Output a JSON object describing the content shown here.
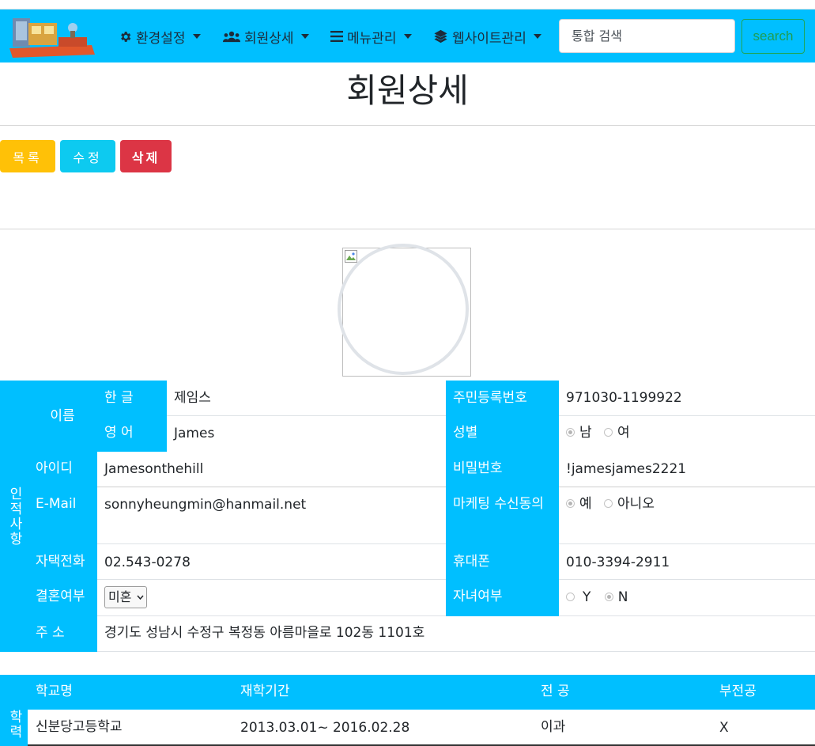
{
  "nav": {
    "items": [
      {
        "label": "환경설정",
        "icon": "gear-icon"
      },
      {
        "label": "회원상세",
        "icon": "users-icon"
      },
      {
        "label": "메뉴관리",
        "icon": "list-icon"
      },
      {
        "label": "웹사이트관리",
        "icon": "layers-icon"
      }
    ],
    "search_placeholder": "통합 검색",
    "search_button": "search"
  },
  "page": {
    "title": "회원상세"
  },
  "actions": {
    "list": "목록",
    "edit": "수정",
    "delete": "삭제"
  },
  "colors": {
    "navbar": "#00bfff",
    "header_cell": "#00bfff",
    "list_button": "#ffc107",
    "edit_button": "#0dcaf0",
    "delete_button": "#dc3545"
  },
  "personal": {
    "section_label": "인적사항",
    "name_label": "이름",
    "korean_label": "한 글",
    "korean_value": "제임스",
    "english_label": "영 어",
    "english_value": "James",
    "rrn_label": "주민등록번호",
    "rrn_value": "971030-1199922",
    "gender_label": "성별",
    "gender_male": "남",
    "gender_female": "여",
    "gender_selected": "남",
    "id_label": "아이디",
    "id_value": "Jamesonthehill",
    "password_label": "비밀번호",
    "password_value": "!jamesjames2221",
    "email_label": "E-Mail",
    "email_value": "sonnyheungmin@hanmail.net",
    "marketing_label": "마케팅 수신동의",
    "marketing_yes": "예",
    "marketing_no": "아니오",
    "marketing_selected": "예",
    "home_phone_label": "자택전화",
    "home_phone_value": "02.543-0278",
    "mobile_label": "휴대폰",
    "mobile_value": "010-3394-2911",
    "marital_label": "결혼여부",
    "marital_value": "미혼",
    "children_label": "자녀여부",
    "children_yes": "Y",
    "children_no": "N",
    "children_selected": "N",
    "address_label": "주 소",
    "address_value": "경기도 성남시 수정구 복정동 아름마을로 102동 1101호"
  },
  "education": {
    "section_label": "학력",
    "headers": [
      "학교명",
      "재학기간",
      "전 공",
      "부전공"
    ],
    "rows": [
      {
        "school": "신분당고등학교",
        "period": "2013.03.01~ 2016.02.28",
        "major": "이과",
        "minor": "X"
      }
    ]
  }
}
